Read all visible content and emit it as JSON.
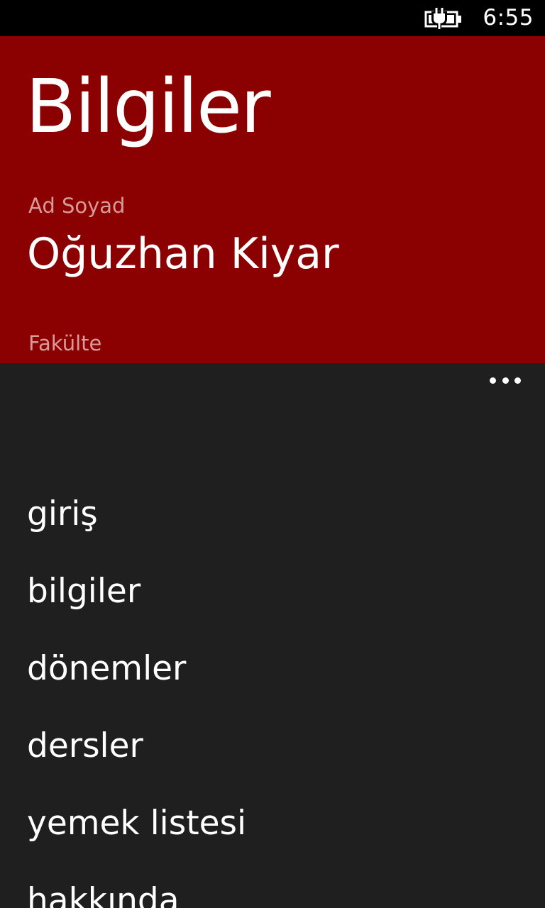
{
  "status_bar": {
    "time": "6:55",
    "battery_icon": "battery-charging-icon"
  },
  "page": {
    "title": "Bilgiler",
    "background_color": "#8b0000",
    "fields": {
      "name_label": "Ad Soyad",
      "name_value": "Oğuzhan Kiyar",
      "faculty_label": "Fakülte"
    }
  },
  "app_bar": {
    "more_icon": "ellipsis-icon",
    "menu_items": [
      {
        "label": "giriş"
      },
      {
        "label": "bilgiler"
      },
      {
        "label": "dönemler"
      },
      {
        "label": "dersler"
      },
      {
        "label": "yemek listesi"
      },
      {
        "label": "hakkında"
      }
    ]
  }
}
